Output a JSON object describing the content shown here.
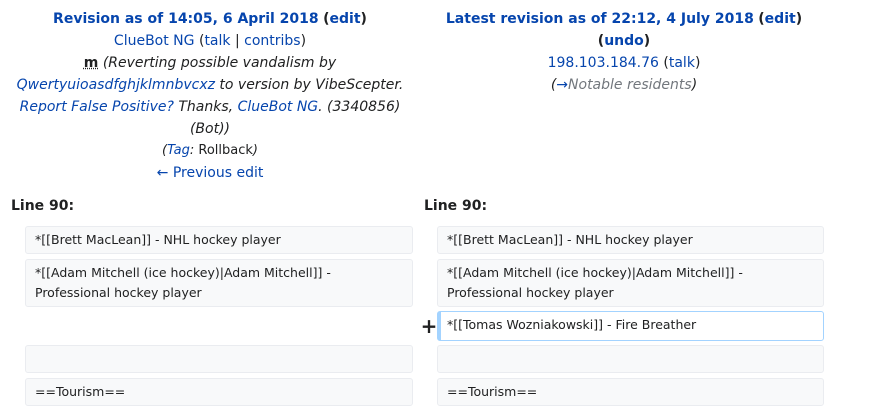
{
  "left_header": {
    "title": "Revision as of 14:05, 6 April 2018",
    "edit_label": "edit",
    "user": "ClueBot NG",
    "talk_label": "talk",
    "separator": "|",
    "contribs_label": "contribs",
    "minor_flag": "m",
    "summary_pre": "(Reverting possible vandalism by",
    "summary_user_link": "Qwertyuioasdfghjklmnbvcxz",
    "summary_mid": "to version by VibeScepter.",
    "summary_report_link": "Report False Positive?",
    "summary_thanks": "Thanks,",
    "summary_bot_link": "ClueBot NG",
    "summary_post": ". (3340856) (Bot))",
    "tag_label": "Tag",
    "tag_value": "Rollback",
    "prev_label": "← Previous edit"
  },
  "right_header": {
    "title": "Latest revision as of 22:12, 4 July 2018",
    "edit_label": "edit",
    "undo_label": "undo",
    "user_ip": "198.103.184.76",
    "talk_label": "talk",
    "section_arrow": "→",
    "section_name": "Notable residents"
  },
  "line_left": "Line 90:",
  "line_right": "Line 90:",
  "diff": {
    "left": [
      "*[[Brett MacLean]] - NHL hockey player",
      "*[[Adam Mitchell (ice hockey)|Adam Mitchell]] - Professional hockey player",
      "",
      "==Tourism=="
    ],
    "right": [
      "*[[Brett MacLean]] - NHL hockey player",
      "*[[Adam Mitchell (ice hockey)|Adam Mitchell]] - Professional hockey player",
      "*[[Tomas Wozniakowski]] - Fire Breather",
      "",
      "==Tourism=="
    ],
    "added_marker": "+"
  }
}
